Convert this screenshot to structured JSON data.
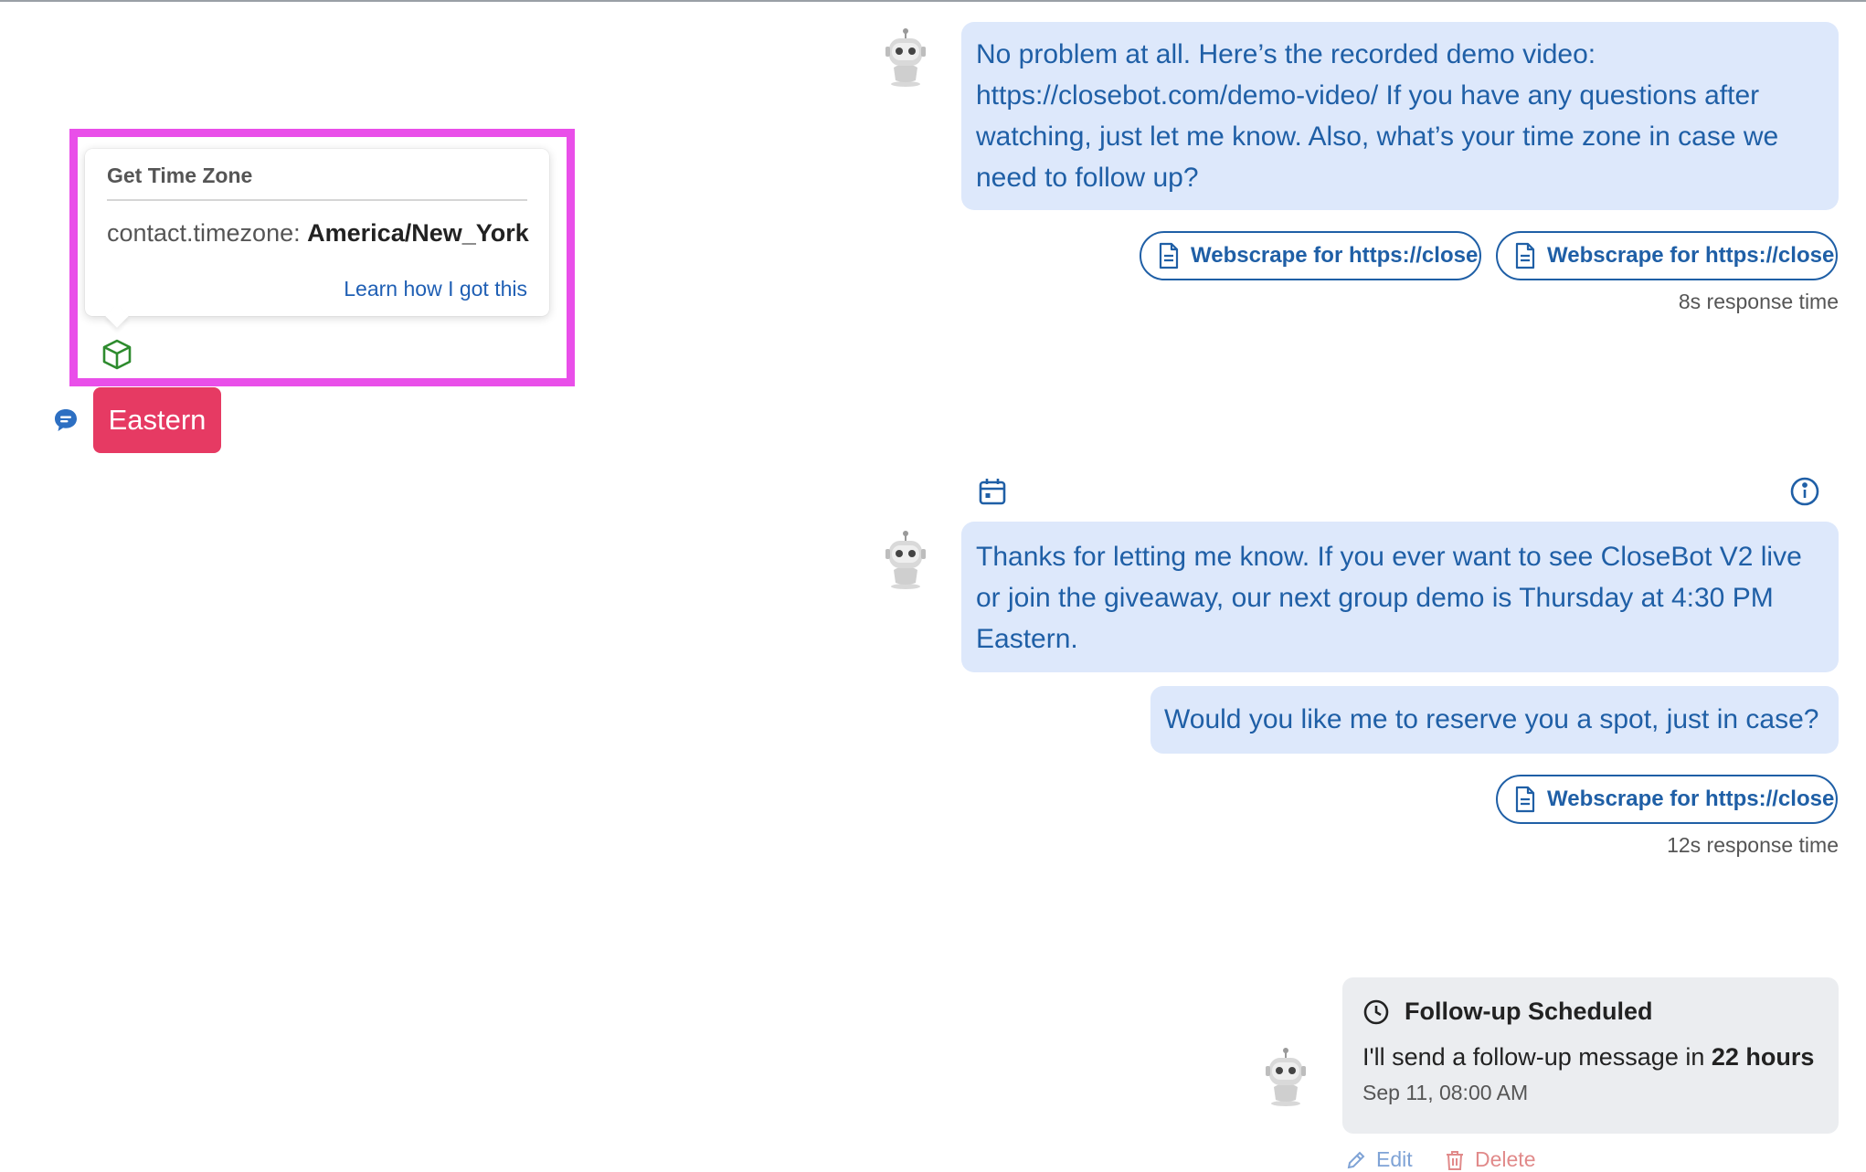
{
  "tooltip": {
    "title": "Get Time Zone",
    "key": "contact.timezone:",
    "value": "America/New_York",
    "learn_link": "Learn how I got this"
  },
  "user_message": {
    "text": "Eastern"
  },
  "bot_message_1": {
    "text": "No problem at all. Here’s the recorded demo video: https://closebot.com/demo-video/ If you have any questions after watching, just let me know. Also, what’s your time zone in case we need to follow up?",
    "sources": [
      "Webscrape for https://closebot.com",
      "Webscrape for https://closebot.com"
    ],
    "response_time": "8s response time"
  },
  "bot_message_2": {
    "text": "Thanks for letting me know. If you ever want to see CloseBot V2 live or join the giveaway, our next group demo is Thursday at 4:30 PM Eastern.",
    "text_2": "Would you like me to reserve you a spot, just in case?",
    "sources": [
      "Webscrape for https://closebot.com"
    ],
    "response_time": "12s response time"
  },
  "followup": {
    "title": "Follow-up Scheduled",
    "body_prefix": "I'll send a follow-up message in ",
    "body_bold": "22 hours",
    "date": "Sep 11, 08:00 AM",
    "edit_label": "Edit",
    "delete_label": "Delete"
  },
  "colors": {
    "bot_bubble": "#dde8fb",
    "bot_text": "#1f5fa6",
    "user_bubble": "#e63a63",
    "highlight": "#e94fe9"
  }
}
